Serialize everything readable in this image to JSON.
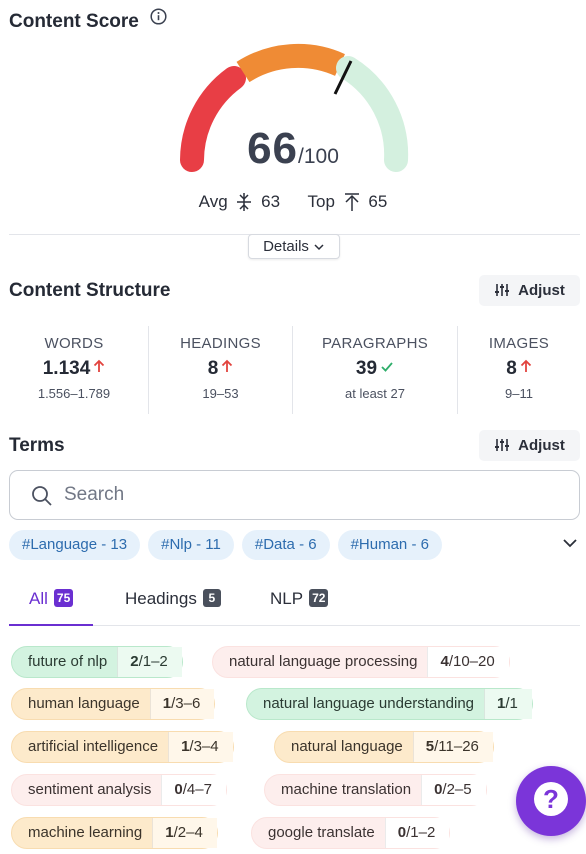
{
  "content_score": {
    "title": "Content Score",
    "score": "66",
    "max": "/100",
    "score_value": 66,
    "avg_label": "Avg",
    "avg_value": "63",
    "top_label": "Top",
    "top_value": "65",
    "details_label": "Details",
    "colors": {
      "low": "#e83e45",
      "mid": "#ef8b35",
      "high": "#d4f0df",
      "marker": "#111111"
    }
  },
  "content_structure": {
    "title": "Content Structure",
    "adjust_label": "Adjust",
    "metrics": [
      {
        "label": "WORDS",
        "value": "1.134",
        "range": "1.556–1.789",
        "status": "up"
      },
      {
        "label": "HEADINGS",
        "value": "8",
        "range": "19–53",
        "status": "up"
      },
      {
        "label": "PARAGRAPHS",
        "value": "39",
        "range": "at least 27",
        "status": "ok"
      },
      {
        "label": "IMAGES",
        "value": "8",
        "range": "9–11",
        "status": "up"
      }
    ]
  },
  "terms": {
    "title": "Terms",
    "adjust_label": "Adjust",
    "search_placeholder": "Search",
    "hashtags": [
      "#Language - 13",
      "#Nlp - 11",
      "#Data - 6",
      "#Human - 6"
    ],
    "tabs": [
      {
        "label": "All",
        "count": "75",
        "active": true
      },
      {
        "label": "Headings",
        "count": "5",
        "active": false
      },
      {
        "label": "NLP",
        "count": "72",
        "active": false
      }
    ],
    "items": [
      {
        "term": "future of nlp",
        "current": "2",
        "range": "/1–2",
        "status": "green"
      },
      {
        "term": "natural language processing",
        "current": "4",
        "range": "/10–20",
        "status": "red"
      },
      {
        "term": "human language",
        "current": "1",
        "range": "/3–6",
        "status": "orange"
      },
      {
        "term": "natural language understanding",
        "current": "1",
        "range": "/1",
        "status": "green"
      },
      {
        "term": "artificial intelligence",
        "current": "1",
        "range": "/3–4",
        "status": "orange"
      },
      {
        "term": "natural language",
        "current": "5",
        "range": "/11–26",
        "status": "orange"
      },
      {
        "term": "sentiment analysis",
        "current": "0",
        "range": "/4–7",
        "status": "red"
      },
      {
        "term": "machine translation",
        "current": "0",
        "range": "/2–5",
        "status": "red"
      },
      {
        "term": "machine learning",
        "current": "1",
        "range": "/2–4",
        "status": "orange"
      },
      {
        "term": "google translate",
        "current": "0",
        "range": "/1–2",
        "status": "red"
      }
    ]
  },
  "help_label": "?"
}
